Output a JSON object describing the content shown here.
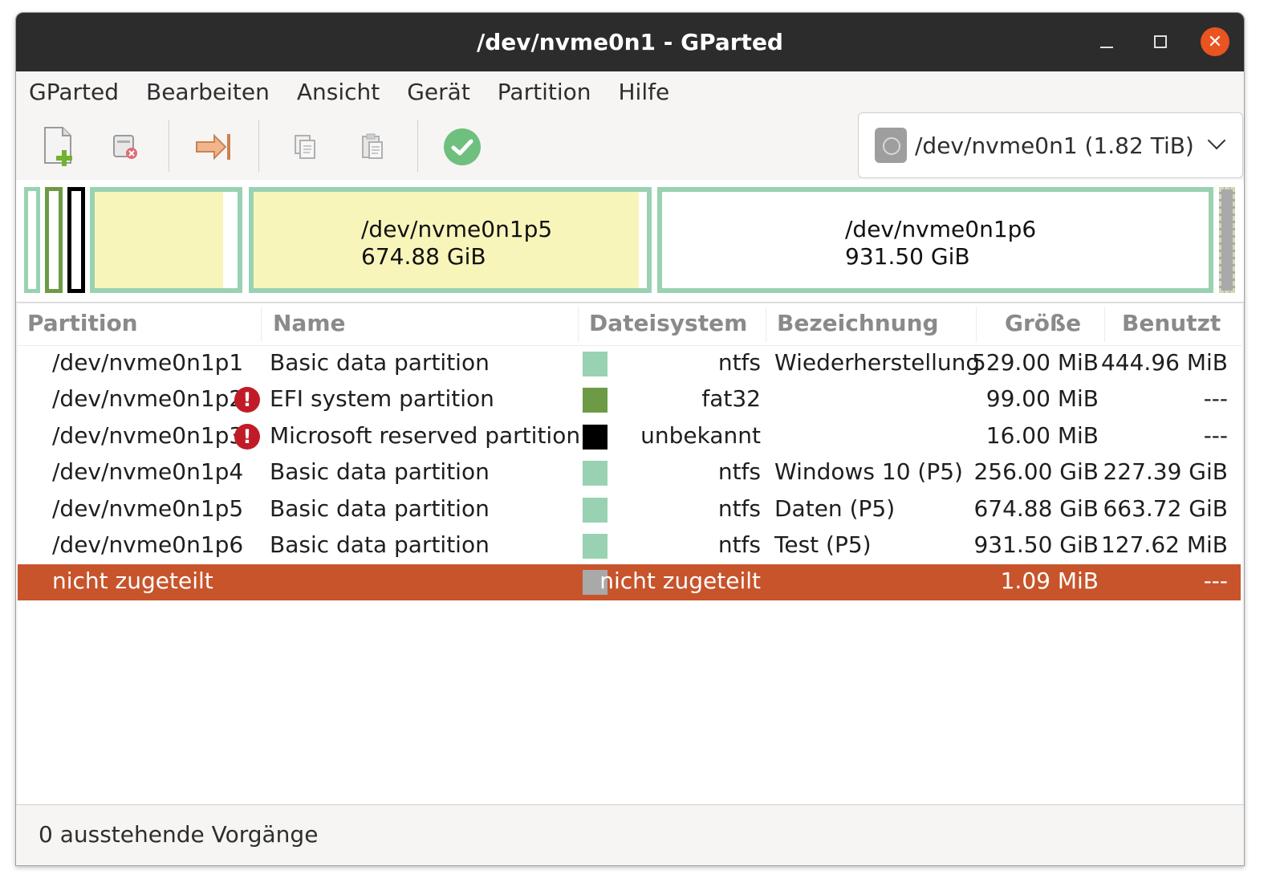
{
  "window": {
    "title": "/dev/nvme0n1 - GParted"
  },
  "menubar": {
    "items": [
      {
        "label": "GParted"
      },
      {
        "label": "Bearbeiten"
      },
      {
        "label": "Ansicht"
      },
      {
        "label": "Gerät"
      },
      {
        "label": "Partition"
      },
      {
        "label": "Hilfe"
      }
    ]
  },
  "toolbar": {
    "tools": [
      {
        "icon": "new-partition-icon"
      },
      {
        "icon": "delete-partition-icon"
      },
      {
        "icon": "resize-move-icon"
      },
      {
        "icon": "copy-icon"
      },
      {
        "icon": "paste-icon"
      },
      {
        "icon": "apply-icon"
      }
    ],
    "device": "/dev/nvme0n1 (1.82 TiB)"
  },
  "colors": {
    "ntfs": "#99d2b2",
    "fat32": "#6d9b45",
    "unknown": "#000000",
    "unallocated": "#a9a9a9",
    "used": "#f8f5bb",
    "selected": "#c7542b",
    "warning": "#c01c28"
  },
  "map": {
    "p5": {
      "name": "/dev/nvme0n1p5",
      "size": "674.88 GiB"
    },
    "p6": {
      "name": "/dev/nvme0n1p6",
      "size": "931.50 GiB"
    }
  },
  "table": {
    "headers": {
      "partition": "Partition",
      "name": "Name",
      "filesystem": "Dateisystem",
      "label": "Bezeichnung",
      "size": "Größe",
      "used": "Benutzt"
    },
    "rows": [
      {
        "partition": "/dev/nvme0n1p1",
        "warning": false,
        "name": "Basic data partition",
        "fs": "ntfs",
        "fs_color": "#99d2b2",
        "label": "Wiederherstellung",
        "size": "529.00 MiB",
        "used": "444.96 MiB"
      },
      {
        "partition": "/dev/nvme0n1p2",
        "warning": true,
        "name": "EFI system partition",
        "fs": "fat32",
        "fs_color": "#6d9b45",
        "label": "",
        "size": "99.00 MiB",
        "used": "---"
      },
      {
        "partition": "/dev/nvme0n1p3",
        "warning": true,
        "name": "Microsoft reserved partition",
        "fs": "unbekannt",
        "fs_color": "#000000",
        "label": "",
        "size": "16.00 MiB",
        "used": "---"
      },
      {
        "partition": "/dev/nvme0n1p4",
        "warning": false,
        "name": "Basic data partition",
        "fs": "ntfs",
        "fs_color": "#99d2b2",
        "label": "Windows 10 (P5)",
        "size": "256.00 GiB",
        "used": "227.39 GiB"
      },
      {
        "partition": "/dev/nvme0n1p5",
        "warning": false,
        "name": "Basic data partition",
        "fs": "ntfs",
        "fs_color": "#99d2b2",
        "label": "Daten (P5)",
        "size": "674.88 GiB",
        "used": "663.72 GiB"
      },
      {
        "partition": "/dev/nvme0n1p6",
        "warning": false,
        "name": "Basic data partition",
        "fs": "ntfs",
        "fs_color": "#99d2b2",
        "label": "Test (P5)",
        "size": "931.50 GiB",
        "used": "127.62 MiB"
      },
      {
        "partition": "nicht zugeteilt",
        "warning": false,
        "name": "",
        "fs": "nicht zugeteilt",
        "fs_color": "#a9a9a9",
        "label": "",
        "size": "1.09 MiB",
        "used": "---",
        "selected": true
      }
    ]
  },
  "status": {
    "text": "0 ausstehende Vorgänge"
  }
}
